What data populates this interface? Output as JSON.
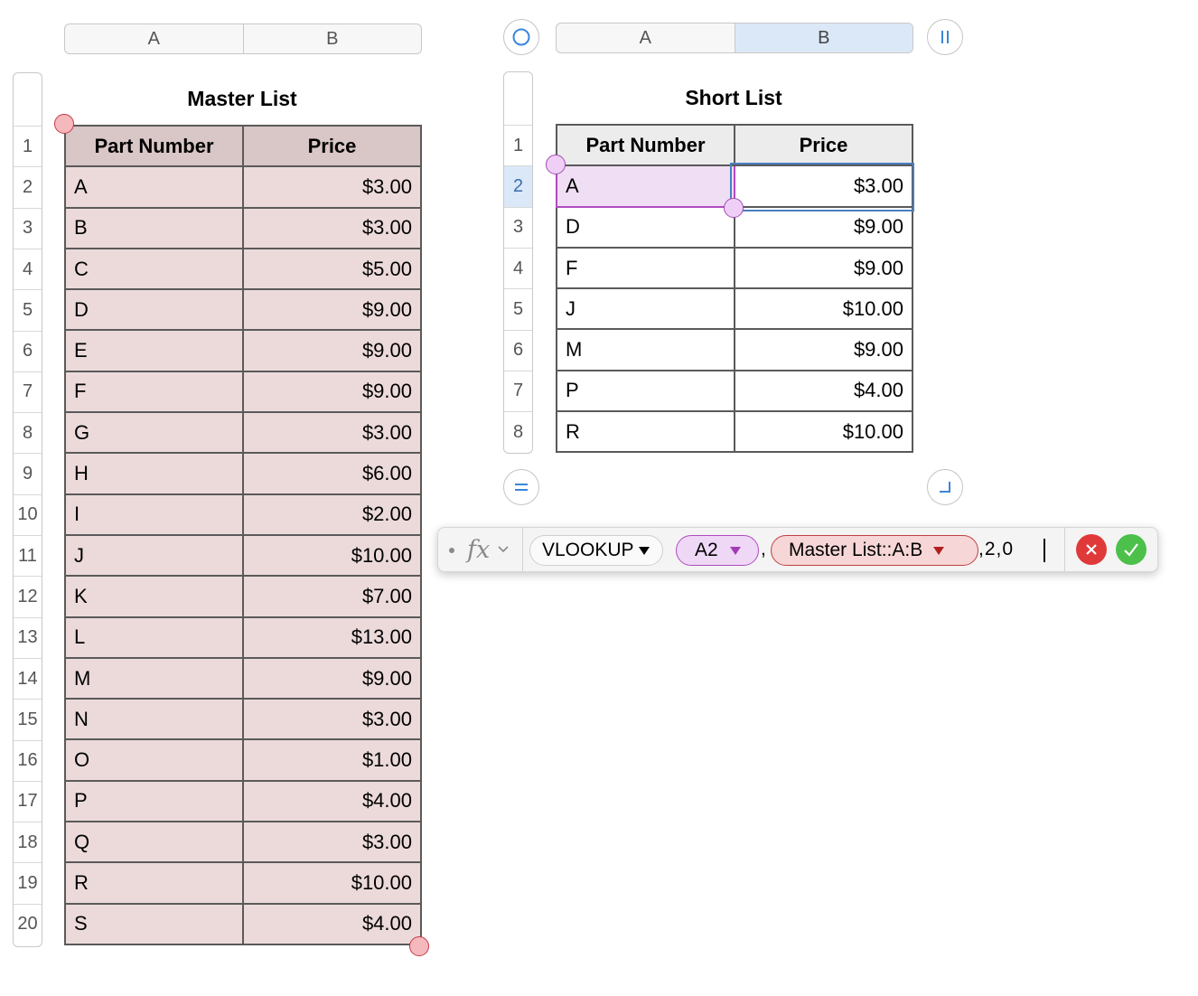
{
  "master_table": {
    "title": "Master List",
    "columns": [
      "A",
      "B"
    ],
    "headers": [
      "Part Number",
      "Price"
    ],
    "rows": [
      [
        "A",
        "$3.00"
      ],
      [
        "B",
        "$3.00"
      ],
      [
        "C",
        "$5.00"
      ],
      [
        "D",
        "$9.00"
      ],
      [
        "E",
        "$9.00"
      ],
      [
        "F",
        "$9.00"
      ],
      [
        "G",
        "$3.00"
      ],
      [
        "H",
        "$6.00"
      ],
      [
        "I",
        "$2.00"
      ],
      [
        "J",
        "$10.00"
      ],
      [
        "K",
        "$7.00"
      ],
      [
        "L",
        "$13.00"
      ],
      [
        "M",
        "$9.00"
      ],
      [
        "N",
        "$3.00"
      ],
      [
        "O",
        "$1.00"
      ],
      [
        "P",
        "$4.00"
      ],
      [
        "Q",
        "$3.00"
      ],
      [
        "R",
        "$10.00"
      ],
      [
        "S",
        "$4.00"
      ]
    ],
    "row_numbers": [
      "1",
      "2",
      "3",
      "4",
      "5",
      "6",
      "7",
      "8",
      "9",
      "10",
      "11",
      "12",
      "13",
      "14",
      "15",
      "16",
      "17",
      "18",
      "19",
      "20"
    ],
    "accent_color": "#7a1d1d"
  },
  "short_table": {
    "title": "Short List",
    "columns": [
      "A",
      "B"
    ],
    "selected_column": "B",
    "headers": [
      "Part Number",
      "Price"
    ],
    "rows": [
      [
        "A",
        "$3.00"
      ],
      [
        "D",
        "$9.00"
      ],
      [
        "F",
        "$9.00"
      ],
      [
        "J",
        "$10.00"
      ],
      [
        "M",
        "$9.00"
      ],
      [
        "P",
        "$4.00"
      ],
      [
        "R",
        "$10.00"
      ]
    ],
    "row_numbers": [
      "1",
      "2",
      "3",
      "4",
      "5",
      "6",
      "7",
      "8"
    ],
    "selected_row": "2",
    "selected_cell": "B2",
    "reference_highlight_color": "#b04bbf"
  },
  "formula_bar": {
    "fx_label": "fx",
    "function_name": "VLOOKUP",
    "arg1": "A2",
    "separator": ",",
    "arg2": "Master List::A:B",
    "rest": ",2,0",
    "cancel_icon": "x-circle-icon",
    "accept_icon": "check-circle-icon",
    "cancel_color": "#e0393a",
    "accept_color": "#4cc04a"
  }
}
